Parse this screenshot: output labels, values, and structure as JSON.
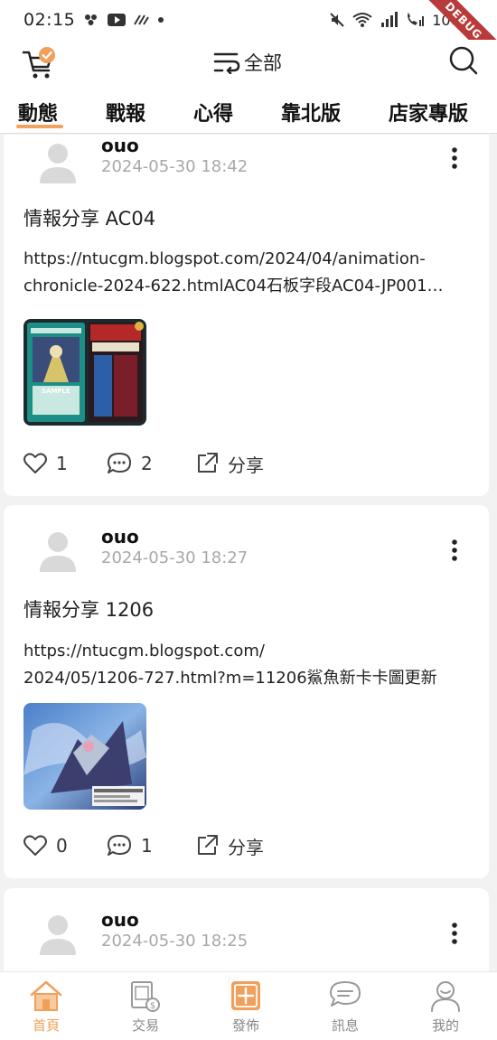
{
  "status_bar": {
    "time": "02:15",
    "battery": "100%",
    "debug_label": "DEBUG"
  },
  "top_bar": {
    "filter_label": "全部"
  },
  "tabs": [
    {
      "label": "動態",
      "active": true
    },
    {
      "label": "戰報",
      "active": false
    },
    {
      "label": "心得",
      "active": false
    },
    {
      "label": "靠北版",
      "active": false
    },
    {
      "label": "店家專版",
      "active": false
    }
  ],
  "posts": [
    {
      "username": "ouo",
      "timestamp": "2024-05-30 18:42",
      "title": "情報分享 AC04",
      "body": "https://ntucgm.blogspot.com/2024/04/animation-chronicle-2024-622.htmlAC04石板字段AC04-JP001…",
      "likes": "1",
      "comments": "2",
      "share_label": "分享",
      "image_alt": "animation chronicle 2024"
    },
    {
      "username": "ouo",
      "timestamp": "2024-05-30 18:27",
      "title": "情報分享 1206",
      "body": "https://ntucgm.blogspot.com/\n2024/05/1206-727.html?m=11206鯊魚新卡卡圖更新",
      "likes": "0",
      "comments": "1",
      "share_label": "分享",
      "image_alt": "card art"
    },
    {
      "username": "ouo",
      "timestamp": "2024-05-30 18:25"
    }
  ],
  "bottom_nav": [
    {
      "label": "首頁",
      "icon": "home-icon",
      "active": true
    },
    {
      "label": "交易",
      "icon": "trade-icon",
      "active": false
    },
    {
      "label": "發佈",
      "icon": "publish-icon",
      "active": false
    },
    {
      "label": "訊息",
      "icon": "message-icon",
      "active": false
    },
    {
      "label": "我的",
      "icon": "profile-icon",
      "active": false
    }
  ],
  "colors": {
    "accent": "#f0a05a",
    "muted": "#a8a8a8"
  }
}
